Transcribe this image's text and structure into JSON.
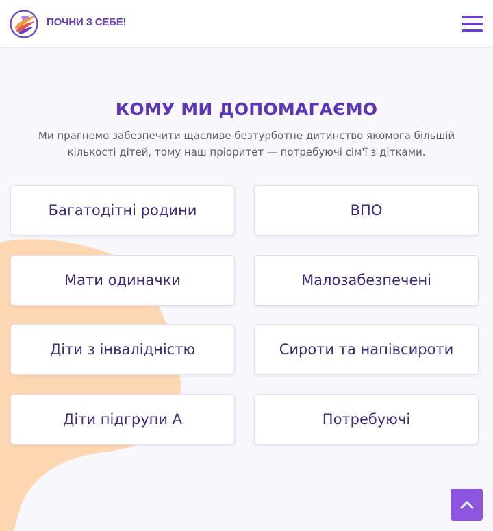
{
  "header": {
    "brand": "ПОЧНИ З СЕБЕ!",
    "logo_icon": "phoenix-logo-icon",
    "menu_icon": "hamburger-menu-icon"
  },
  "section": {
    "title": "КОМУ МИ ДОПОМАГАЄМО",
    "description": "Ми прагнемо забезпечити щасливе безтурботне дитинство якомога більшій кількості дітей, тому наш пріоритет — потребуючі сім'ї з дітками."
  },
  "cards": [
    "Багатодітні родини",
    "ВПО",
    "Мати одиначки",
    "Малозабезпечені",
    "Діти з інвалідністю",
    "Сироти та напівсироти",
    "Діти підгрупи А",
    "Потребуючі"
  ],
  "scroll_top": {
    "icon": "chevron-up-icon"
  },
  "colors": {
    "accent": "#6a3fc4",
    "title": "#5b36b6",
    "card_text": "#3e2a7a",
    "blob": "#fdd7b1",
    "scroll_button": "#8e56e0",
    "background": "#f8f7fc"
  }
}
